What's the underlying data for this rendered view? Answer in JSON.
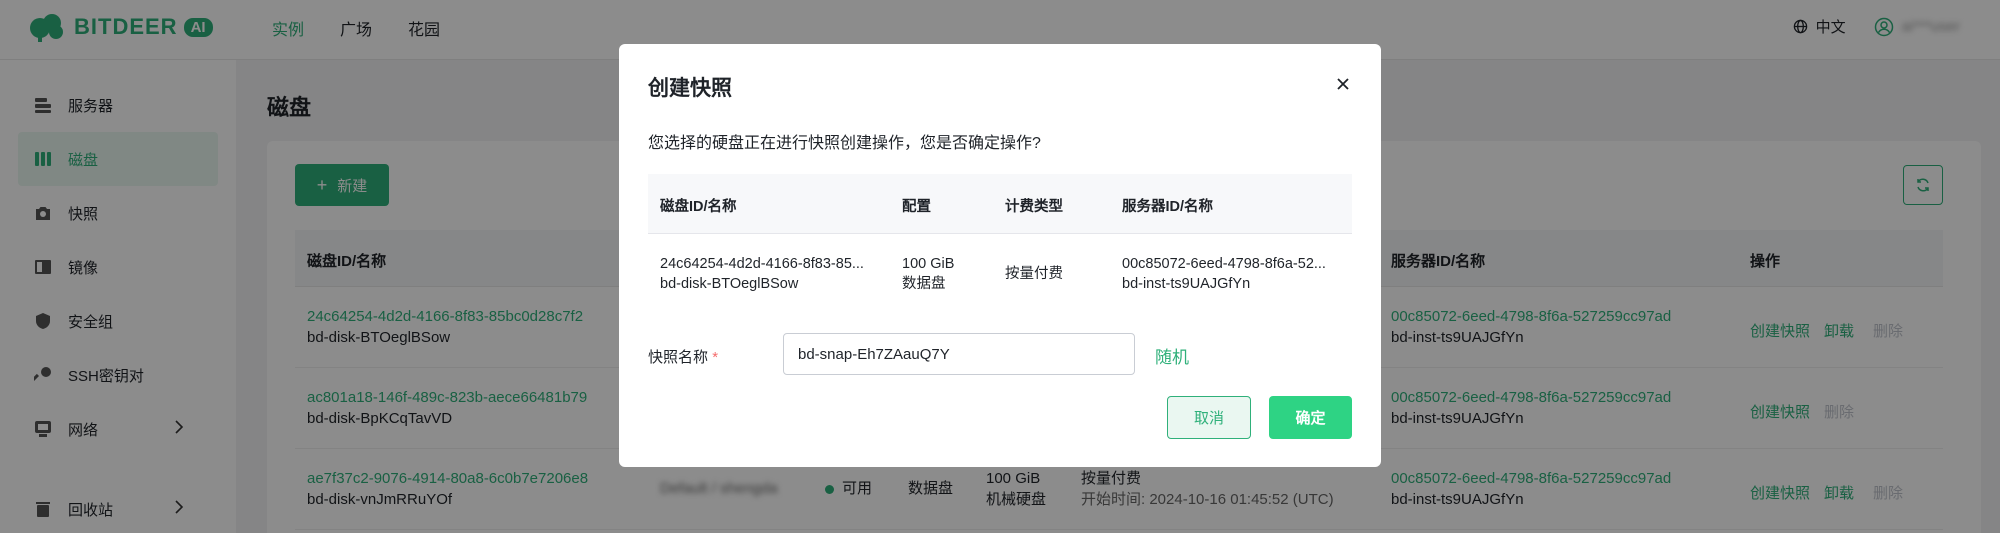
{
  "brand": {
    "name": "BITDEER",
    "badge": "AI"
  },
  "nav": {
    "items": [
      "实例",
      "广场",
      "花园"
    ]
  },
  "topbar": {
    "language": "中文",
    "user": "ai***user"
  },
  "sidebar": {
    "items": [
      {
        "label": "服务器",
        "icon": "server-icon"
      },
      {
        "label": "磁盘",
        "icon": "disk-icon"
      },
      {
        "label": "快照",
        "icon": "camera-icon"
      },
      {
        "label": "镜像",
        "icon": "image-icon"
      },
      {
        "label": "安全组",
        "icon": "shield-icon"
      },
      {
        "label": "SSH密钥对",
        "icon": "key-icon"
      },
      {
        "label": "网络",
        "icon": "network-icon"
      }
    ],
    "bottom": {
      "label": "回收站",
      "icon": "trash-icon"
    }
  },
  "page": {
    "title": "磁盘",
    "new_button": "新建",
    "columns": {
      "disk": "磁盘ID/名称",
      "server": "服务器ID/名称",
      "actions": "操作"
    },
    "rows": [
      {
        "disk_id": "24c64254-4d2d-4166-8f83-85bc0d28c7f2",
        "disk_name": "bd-disk-BTOeglBSow",
        "server_id": "00c85072-6eed-4798-8f6a-527259cc97ad",
        "server_name": "bd-inst-ts9UAJGfYn",
        "actions": [
          "创建快照",
          "卸载",
          "删除"
        ]
      },
      {
        "disk_id": "ac801a18-146f-489c-823b-aece66481b79",
        "disk_name": "bd-disk-BpKCqTavVD",
        "server_id": "00c85072-6eed-4798-8f6a-527259cc97ad",
        "server_name": "bd-inst-ts9UAJGfYn",
        "actions": [
          "创建快照",
          "删除"
        ]
      },
      {
        "disk_id": "ae7f37c2-9076-4914-80a8-6c0b7e7206e8",
        "disk_name": "bd-disk-vnJmRRuYOf",
        "blurred": "Default / shengda",
        "status": "可用",
        "type": "数据盘",
        "size": "100 GiB",
        "size_type": "机械硬盘",
        "billing": "按量付费",
        "start_time": "开始时间: 2024-10-16 01:45:52 (UTC)",
        "server_id": "00c85072-6eed-4798-8f6a-527259cc97ad",
        "server_name": "bd-inst-ts9UAJGfYn",
        "actions": [
          "创建快照",
          "卸载",
          "删除"
        ]
      }
    ]
  },
  "modal": {
    "title": "创建快照",
    "question": "您选择的硬盘正在进行快照创建操作，您是否确定操作?",
    "columns": [
      "磁盘ID/名称",
      "配置",
      "计费类型",
      "服务器ID/名称"
    ],
    "row": {
      "disk_id": "24c64254-4d2d-4166-8f83-85...",
      "disk_name": "bd-disk-BTOeglBSow",
      "size": "100 GiB",
      "disk_type": "数据盘",
      "billing": "按量付费",
      "server_id": "00c85072-6eed-4798-8f6a-52...",
      "server_name": "bd-inst-ts9UAJGfYn"
    },
    "snapshot_label": "快照名称",
    "required_mark": "*",
    "snapshot_value": "bd-snap-Eh7ZAauQ7Y",
    "random": "随机",
    "cancel": "取消",
    "confirm": "确定"
  },
  "colors": {
    "accent": "#2fb07a",
    "confirm": "#2ed384",
    "overlay": "rgba(0,0,0,0.45)"
  }
}
